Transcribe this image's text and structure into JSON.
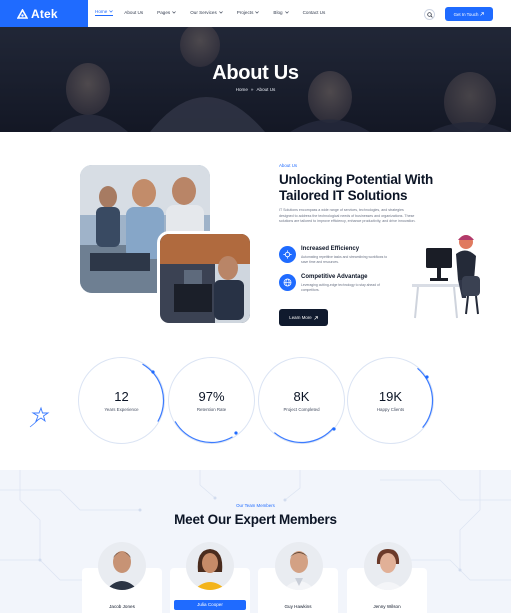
{
  "brand": {
    "name": "Atek",
    "accent": "#1f6bff"
  },
  "nav": {
    "items": [
      {
        "label": "Home",
        "has_menu": true,
        "active": true
      },
      {
        "label": "About Us",
        "has_menu": false,
        "active": false
      },
      {
        "label": "Pages",
        "has_menu": true,
        "active": false
      },
      {
        "label": "Our Services",
        "has_menu": true,
        "active": false
      },
      {
        "label": "Projects",
        "has_menu": true,
        "active": false
      },
      {
        "label": "Blog",
        "has_menu": true,
        "active": false
      },
      {
        "label": "Contact Us",
        "has_menu": false,
        "active": false
      }
    ],
    "search_icon": "search-icon",
    "cta_label": "Get In Touch"
  },
  "hero": {
    "title": "About Us",
    "breadcrumb": {
      "home": "Home",
      "separator": "»",
      "current": "About Us"
    }
  },
  "about": {
    "tag": "About Us",
    "title": "Unlocking Potential With Tailored IT Solutions",
    "description": "IT Solutions encompass a wide range of services, technologies, and strategies designed to address the technological needs of businesses and organizations. These solutions are tailored to improve efficiency, enhance productivity, and drive innovation.",
    "features": [
      {
        "title": "Increased Efficiency",
        "text": "Automating repetitive tasks and streamlining workflows to save time and resources.",
        "icon": "gear-icon"
      },
      {
        "title": "Competitive Advantage",
        "text": "Leveraging cutting-edge technology to stay ahead of competitors.",
        "icon": "globe-icon"
      }
    ],
    "button_label": "Learn More"
  },
  "stats": [
    {
      "value": "12",
      "label": "Years Experience"
    },
    {
      "value": "97%",
      "label": "Retention Rate"
    },
    {
      "value": "8K",
      "label": "Project Completed"
    },
    {
      "value": "19K",
      "label": "Happy Clients"
    }
  ],
  "team": {
    "tag": "Our Team Members",
    "title": "Meet Our Expert Members",
    "members": [
      {
        "name": "Jacob Jones",
        "highlight": false
      },
      {
        "name": "Julia Cooper",
        "highlight": true
      },
      {
        "name": "Guy Hawkins",
        "highlight": false
      },
      {
        "name": "Jenny Wilson",
        "highlight": false
      }
    ]
  }
}
